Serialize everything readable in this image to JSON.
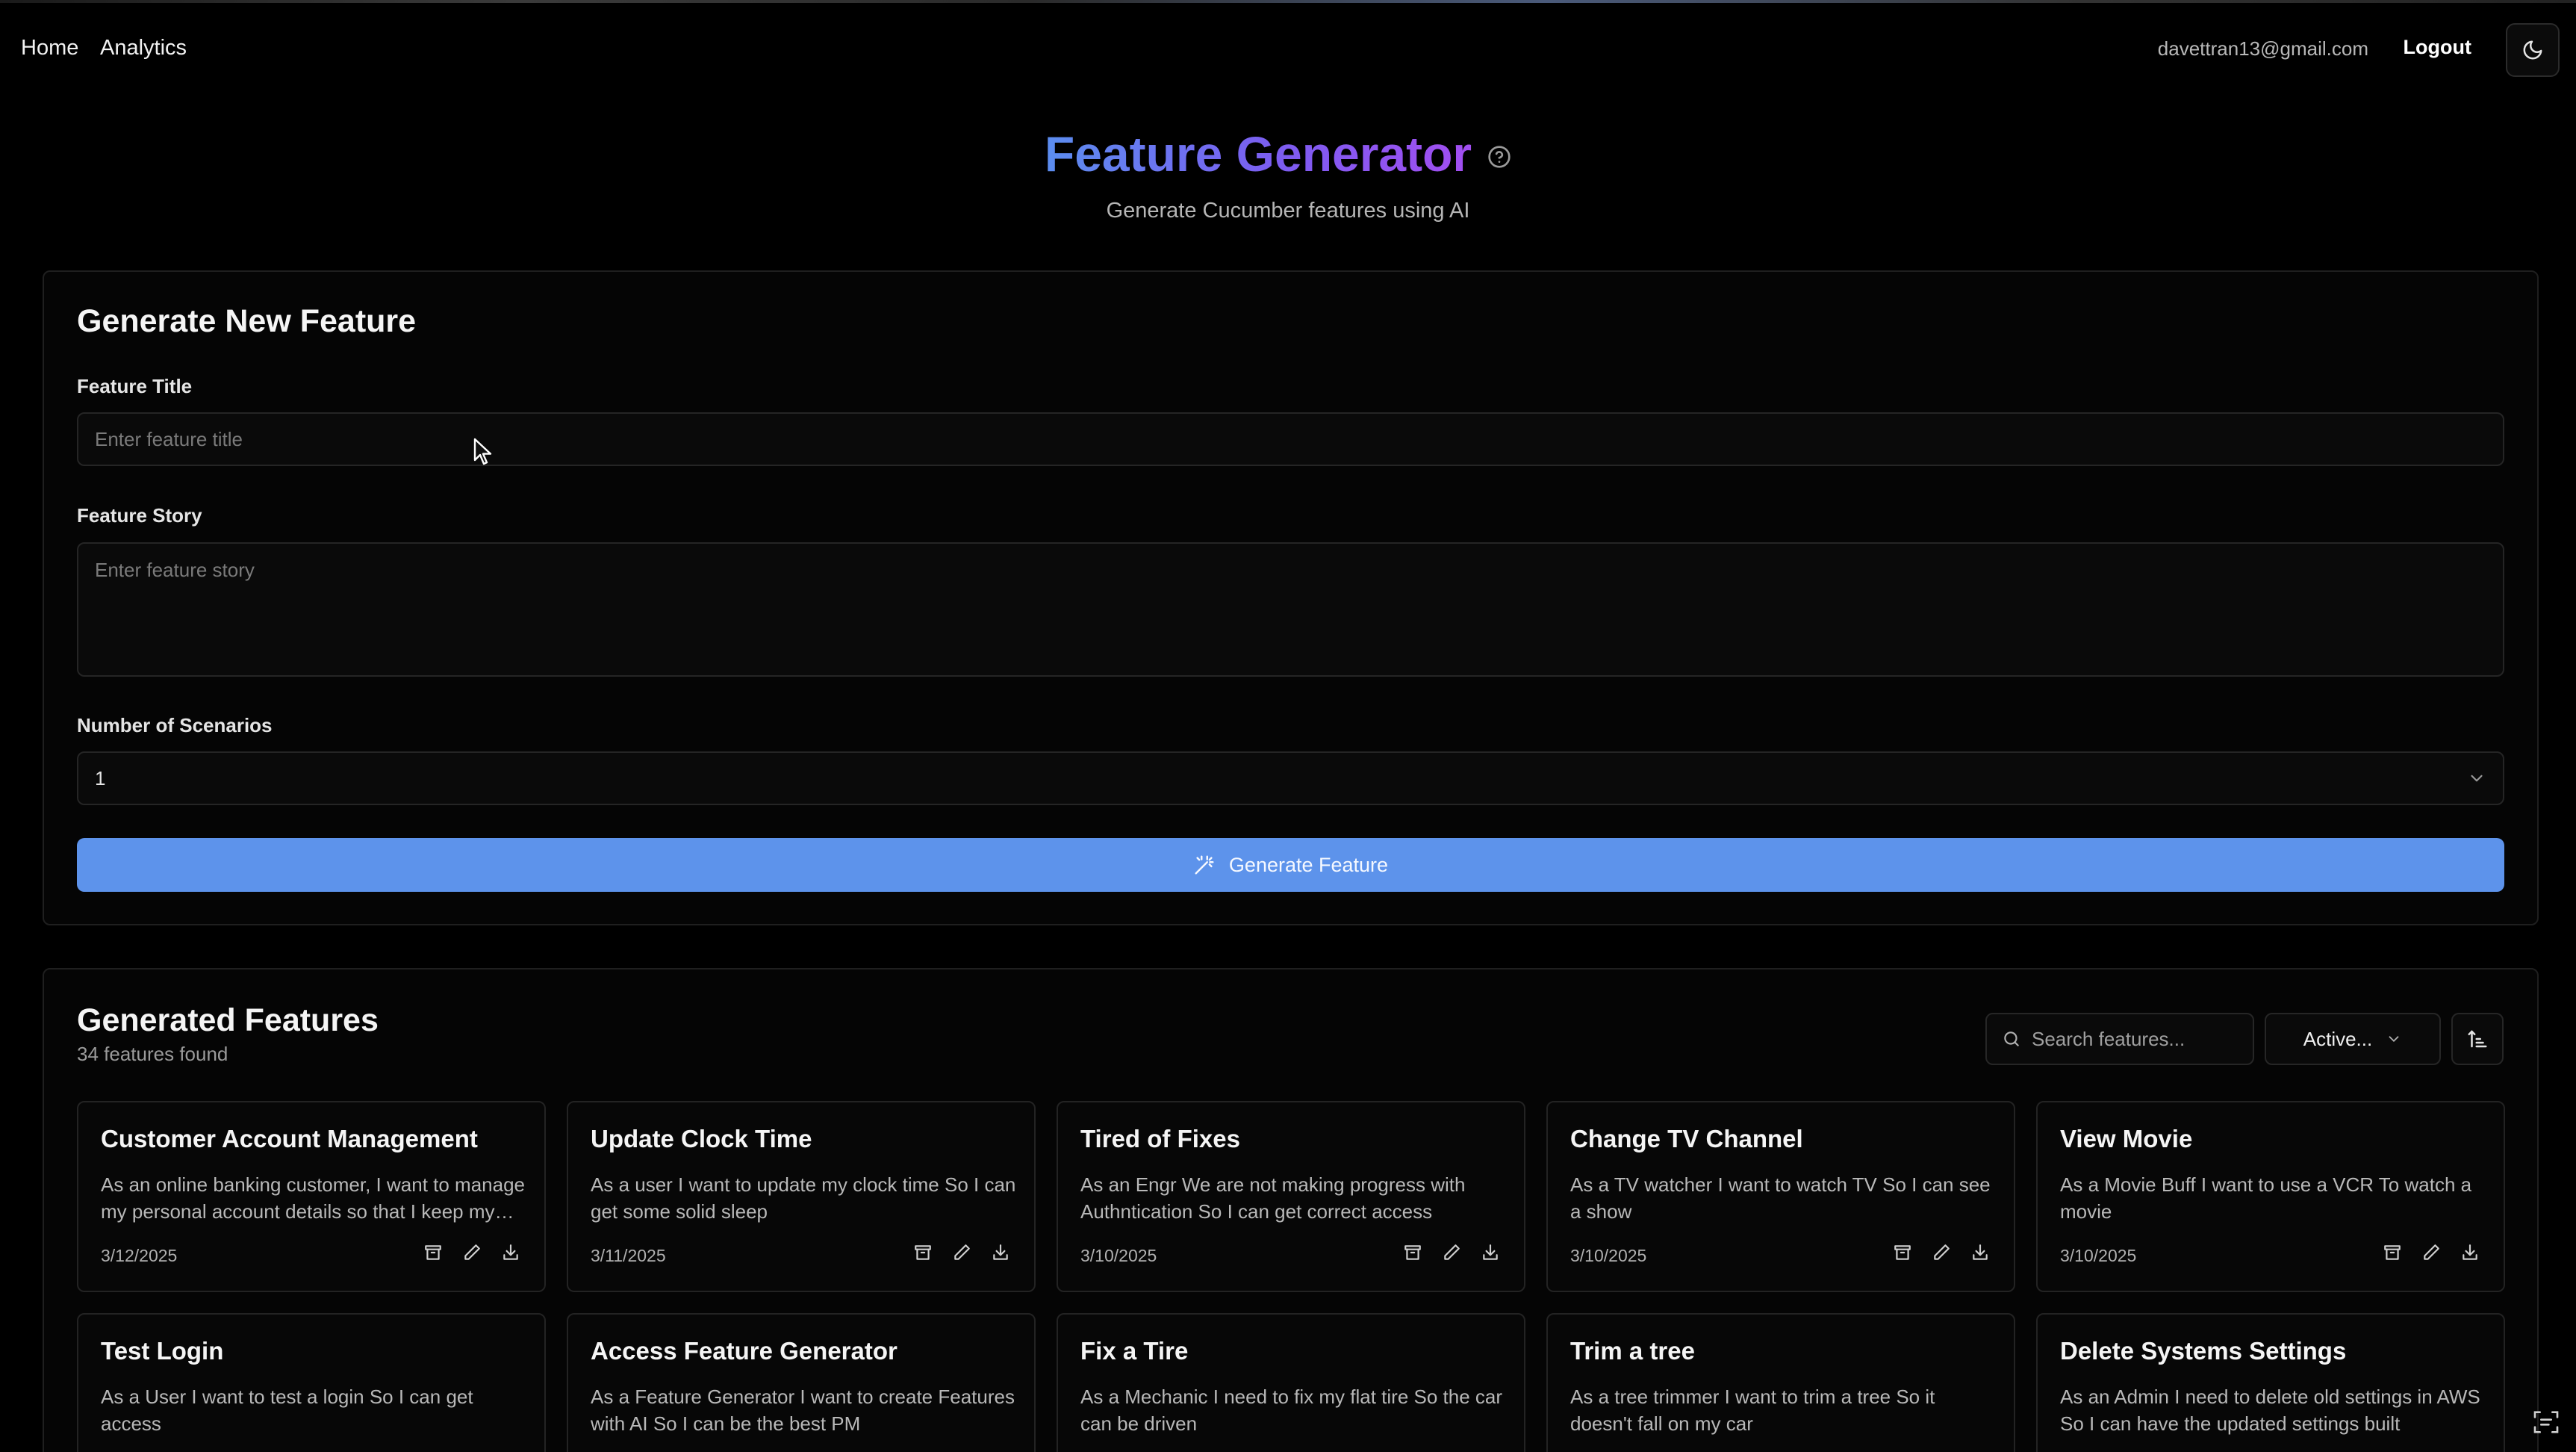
{
  "nav": {
    "home": "Home",
    "analytics": "Analytics",
    "email": "davettran13@gmail.com",
    "logout": "Logout",
    "theme_icon": "moon-icon"
  },
  "header": {
    "title": "Feature Generator",
    "subtitle": "Generate Cucumber features using AI",
    "help_icon": "question-circle-icon"
  },
  "form": {
    "title": "Generate New Feature",
    "feature_title_label": "Feature Title",
    "feature_title_placeholder": "Enter feature title",
    "feature_story_label": "Feature Story",
    "feature_story_placeholder": "Enter feature story",
    "scenarios_label": "Number of Scenarios",
    "scenarios_value": "1",
    "generate_button": "Generate Feature"
  },
  "list": {
    "title": "Generated Features",
    "count_text": "34 features found",
    "search_placeholder": "Search features...",
    "filter_value": "Active...",
    "features": [
      {
        "title": "Customer Account Management",
        "description": "As an online banking customer, I want to manage my personal account details so that I keep my information up to date",
        "date": "3/12/2025"
      },
      {
        "title": "Update Clock Time",
        "description": "As a user I want to update my clock time So I can get some solid sleep",
        "date": "3/11/2025"
      },
      {
        "title": "Tired of Fixes",
        "description": "As an Engr We are not making progress with Authntication So I can get correct access",
        "date": "3/10/2025"
      },
      {
        "title": "Change TV Channel",
        "description": "As a TV watcher I want to watch TV So I can see a show",
        "date": "3/10/2025"
      },
      {
        "title": "View Movie",
        "description": "As a Movie Buff I want to use a VCR To watch a movie",
        "date": "3/10/2025"
      },
      {
        "title": "Test Login",
        "description": "As a User I want to test a login So I can get access",
        "date": ""
      },
      {
        "title": "Access Feature Generator",
        "description": "As a Feature Generator I want to create Features with AI So I can be the best PM",
        "date": ""
      },
      {
        "title": "Fix a Tire",
        "description": "As a Mechanic I need to fix my flat tire So the car can be driven",
        "date": ""
      },
      {
        "title": "Trim a tree",
        "description": "As a tree trimmer I want to trim a tree So it doesn't fall on my car",
        "date": ""
      },
      {
        "title": "Delete Systems Settings",
        "description": "As an Admin I need to delete old settings in AWS So I can have the updated settings built",
        "date": ""
      }
    ]
  },
  "colors": {
    "accent": "#5d93eb",
    "title_gradient_start": "#5b8def",
    "title_gradient_end": "#a24ef0",
    "background": "#000000"
  }
}
